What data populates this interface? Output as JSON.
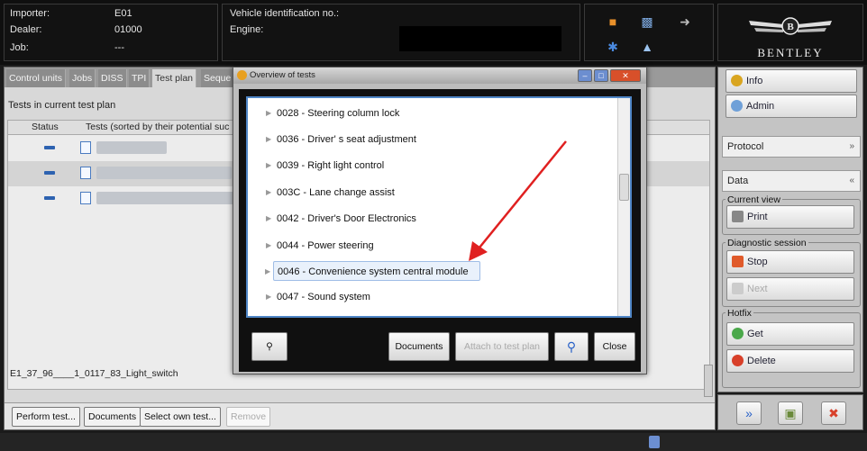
{
  "header": {
    "importer_label": "Importer:",
    "importer_value": "E01",
    "dealer_label": "Dealer:",
    "dealer_value": "01000",
    "job_label": "Job:",
    "job_value": "---",
    "vin_label": "Vehicle identification no.:",
    "engine_label": "Engine:",
    "brand": "BENTLEY"
  },
  "tabs": [
    "Control units",
    "Jobs",
    "DISS",
    "TPI",
    "Test plan",
    "Seque"
  ],
  "active_tab": "Test plan",
  "tests": {
    "title": "Tests in current test plan",
    "col_status": "Status",
    "col_tests": "Tests (sorted by their potential suc",
    "selected_file": "E1_37_96____1_0117_83_Light_switch"
  },
  "bottom_buttons": {
    "perform": "Perform test...",
    "documents": "Documents",
    "select_own": "Select own test...",
    "remove": "Remove"
  },
  "right": {
    "info": "Info",
    "admin": "Admin",
    "protocol": "Protocol",
    "protocol_chevron": "»",
    "data": "Data",
    "data_chevron": "«",
    "current_view": "Current view",
    "print": "Print",
    "diag_session": "Diagnostic session",
    "stop": "Stop",
    "next": "Next",
    "hotfix": "Hotfix",
    "get": "Get",
    "delete": "Delete"
  },
  "modal": {
    "title": "Overview of tests",
    "items": [
      "0028 - Steering column lock",
      "0036 - Driver' s seat adjustment",
      "0039 - Right light control",
      "003C - Lane change assist",
      "0042 - Driver's Door Electronics",
      "0044 - Power steering",
      "0046 - Convenience system central module",
      "0047 - Sound system"
    ],
    "selected_index": 6,
    "buttons": {
      "documents": "Documents",
      "attach": "Attach to test plan",
      "close": "Close"
    }
  },
  "colors": {
    "accent_blue": "#4f86c6",
    "arrow_red": "#e02020"
  }
}
